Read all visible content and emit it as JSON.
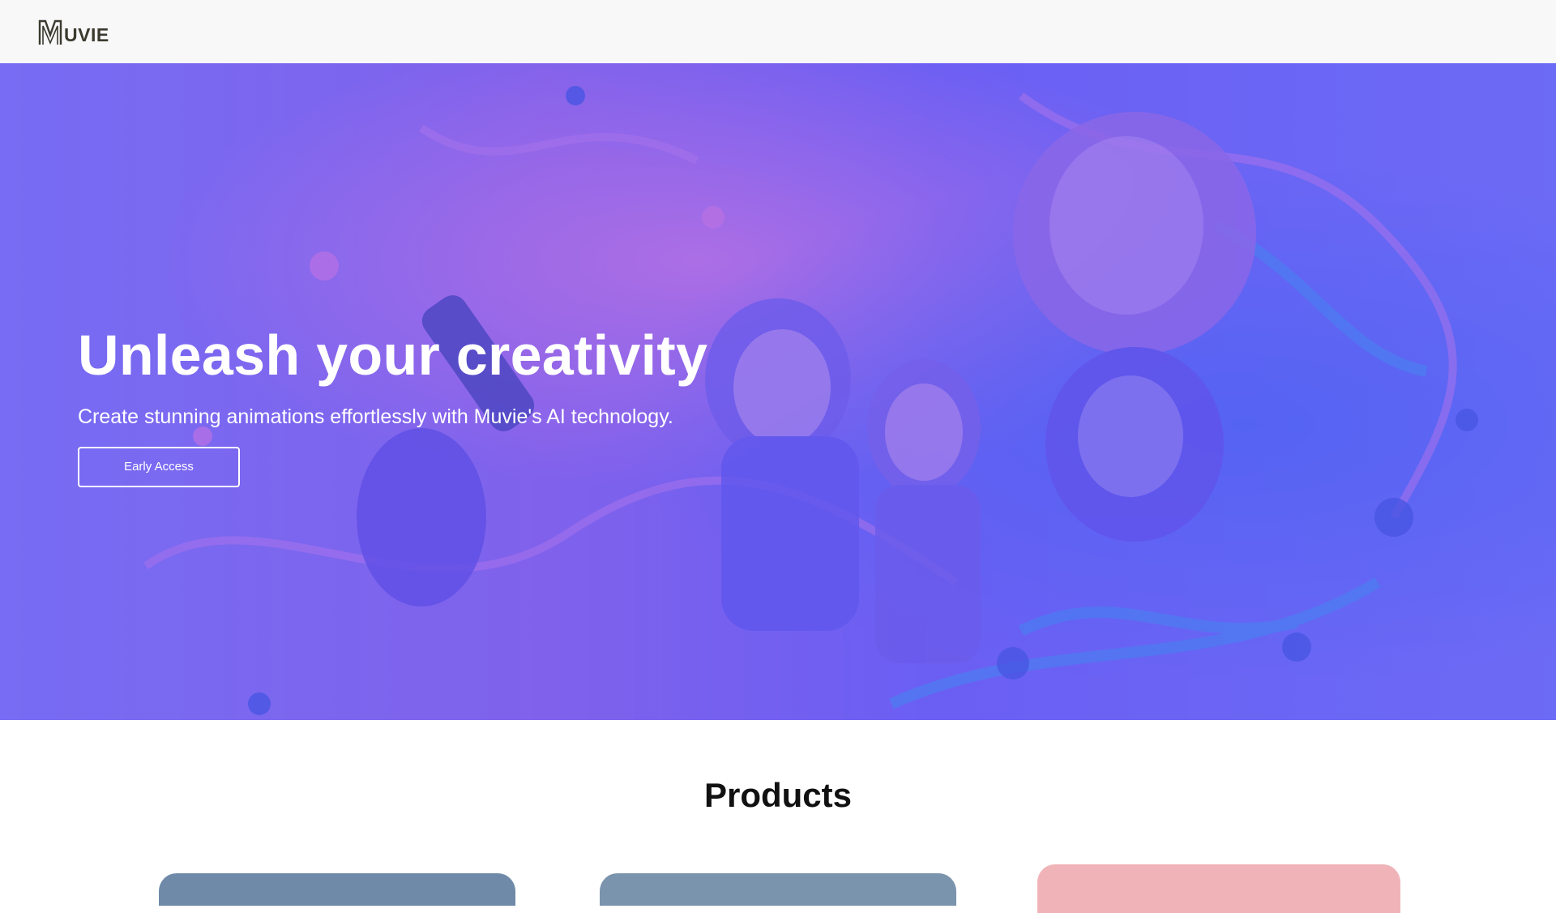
{
  "header": {
    "logo_text": "UVIE",
    "logo_icon": "muvie-m-logo-icon"
  },
  "hero": {
    "title": "Unleash your creativity",
    "subtitle": "Create stunning animations effortlessly with Muvie's AI technology.",
    "cta_label": "Early Access",
    "background": "animated-characters-illustration"
  },
  "products": {
    "title": "Products"
  },
  "colors": {
    "hero_tint": "#7a6bf0",
    "header_bg": "#f8f8f9",
    "logo": "#3c3a2e",
    "card_3": "#f0b4b8"
  }
}
